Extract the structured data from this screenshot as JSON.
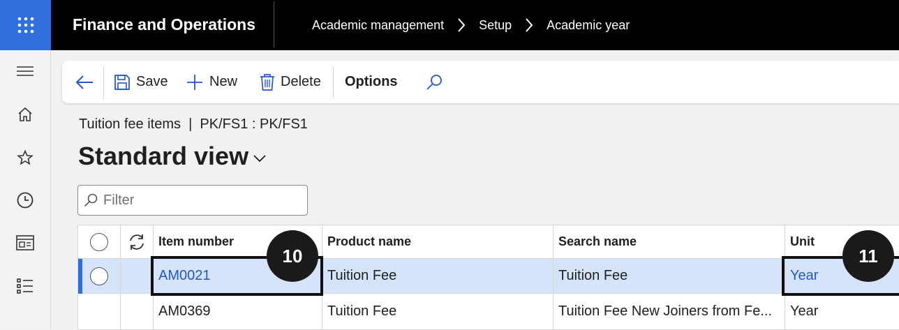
{
  "app": {
    "title": "Finance and Operations"
  },
  "breadcrumb": [
    "Academic management",
    "Setup",
    "Academic year"
  ],
  "nav_rail": [
    "hamburger-icon",
    "home-icon",
    "star-icon",
    "clock-icon",
    "workspace-icon",
    "list-icon"
  ],
  "toolbar": {
    "save_label": "Save",
    "new_label": "New",
    "delete_label": "Delete",
    "options_label": "Options"
  },
  "page": {
    "caption": "Tuition fee items  |  PK/FS1 : PK/FS1",
    "view_title": "Standard view"
  },
  "filter": {
    "placeholder": "Filter",
    "value": ""
  },
  "grid": {
    "columns": [
      "Item number",
      "Product name",
      "Search name",
      "Unit"
    ],
    "rows": [
      {
        "item_number": "AM0021",
        "product_name": "Tuition Fee",
        "search_name": "Tuition Fee",
        "unit": "Year",
        "selected": true
      },
      {
        "item_number": "AM0369",
        "product_name": "Tuition Fee",
        "search_name": "Tuition Fee New Joiners from Fe...",
        "unit": "Year",
        "selected": false
      }
    ]
  },
  "annotations": {
    "badge_1": "10",
    "badge_2": "11"
  },
  "colors": {
    "accent": "#2f6fde",
    "selected_row": "#d6e4fb",
    "link": "#2457c5"
  }
}
